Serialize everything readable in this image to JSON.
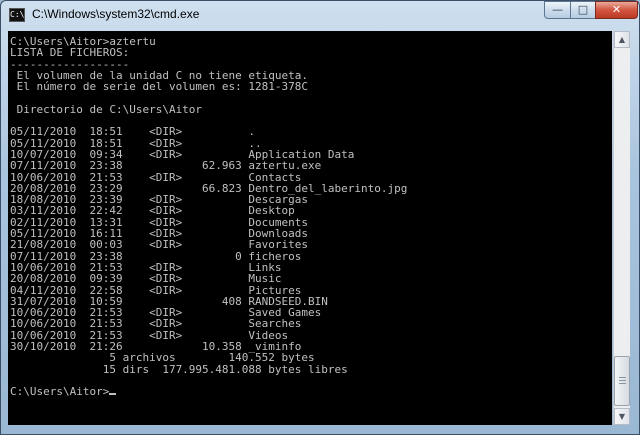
{
  "window": {
    "title": "C:\\Windows\\system32\\cmd.exe",
    "icon_text": "C:\\",
    "controls": {
      "minimize": "—",
      "maximize": "□",
      "close": "✕"
    }
  },
  "console": {
    "lines": [
      "C:\\Users\\Aitor>aztertu",
      "LISTA DE FICHEROS:",
      "------------------",
      " El volumen de la unidad C no tiene etiqueta.",
      " El número de serie del volumen es: 1281-378C",
      "",
      " Directorio de C:\\Users\\Aitor",
      "",
      "05/11/2010  18:51    <DIR>          .",
      "05/11/2010  18:51    <DIR>          ..",
      "10/07/2010  09:34    <DIR>          Application Data",
      "07/11/2010  23:38            62.963 aztertu.exe",
      "10/06/2010  21:53    <DIR>          Contacts",
      "20/08/2010  23:29            66.823 Dentro_del_laberinto.jpg",
      "18/08/2010  23:39    <DIR>          Descargas",
      "03/11/2010  22:42    <DIR>          Desktop",
      "02/11/2010  13:31    <DIR>          Documents",
      "05/11/2010  16:11    <DIR>          Downloads",
      "21/08/2010  00:03    <DIR>          Favorites",
      "07/11/2010  23:38                 0 ficheros",
      "10/06/2010  21:53    <DIR>          Links",
      "20/08/2010  09:39    <DIR>          Music",
      "04/11/2010  22:58    <DIR>          Pictures",
      "31/07/2010  10:59               408 RANDSEED.BIN",
      "10/06/2010  21:53    <DIR>          Saved Games",
      "10/06/2010  21:53    <DIR>          Searches",
      "10/06/2010  21:53    <DIR>          Videos",
      "30/10/2010  21:26            10.358 _viminfo",
      "               5 archivos        140.552 bytes",
      "              15 dirs  177.995.481.088 bytes libres",
      "",
      "C:\\Users\\Aitor>"
    ]
  },
  "scrollbar": {
    "up_arrow": "▲",
    "down_arrow": "▼"
  }
}
